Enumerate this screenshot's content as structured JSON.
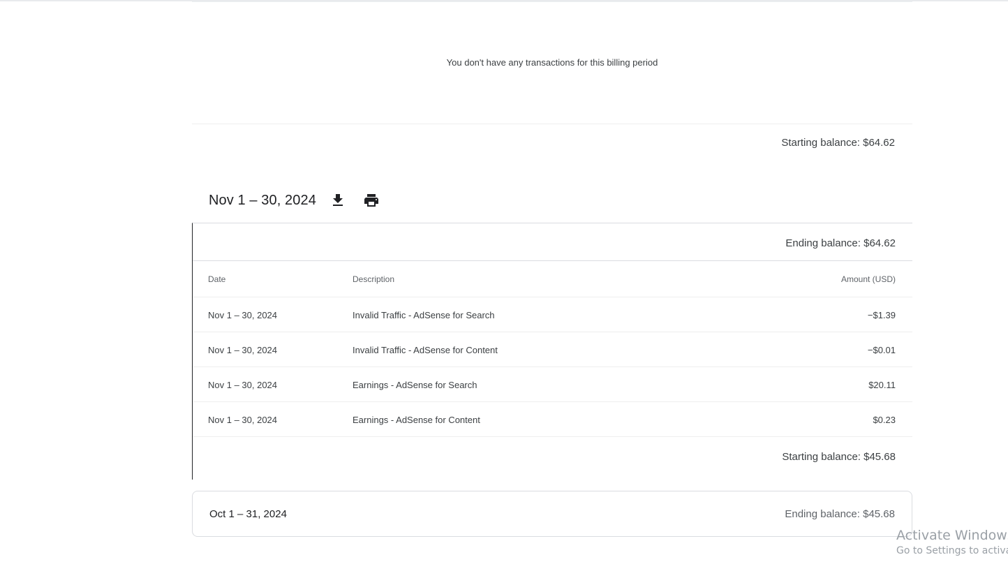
{
  "previous_period": {
    "empty_message": "You don't have any transactions for this billing period",
    "starting_balance": "Starting balance: $64.62"
  },
  "current_period": {
    "title": "Nov 1 – 30, 2024",
    "download_icon": "download-icon",
    "print_icon": "print-icon",
    "ending_balance": "Ending balance: $64.62",
    "columns": {
      "date": "Date",
      "description": "Description",
      "amount": "Amount (USD)"
    },
    "rows": [
      {
        "date": "Nov 1 – 30, 2024",
        "description": "Invalid Traffic - AdSense for Search",
        "amount": "−$1.39"
      },
      {
        "date": "Nov 1 – 30, 2024",
        "description": "Invalid Traffic - AdSense for Content",
        "amount": "−$0.01"
      },
      {
        "date": "Nov 1 – 30, 2024",
        "description": "Earnings - AdSense for Search",
        "amount": "$20.11"
      },
      {
        "date": "Nov 1 – 30, 2024",
        "description": "Earnings - AdSense for Content",
        "amount": "$0.23"
      }
    ],
    "starting_balance": "Starting balance: $45.68"
  },
  "collapsed_period": {
    "title": "Oct 1 – 31, 2024",
    "ending_balance": "Ending balance: $45.68"
  },
  "watermark": {
    "line1": "Activate Windows",
    "line2": "Go to Settings to activat"
  },
  "colors": {
    "text_primary": "#202124",
    "text_secondary": "#5f6368",
    "border": "#dadce0"
  }
}
